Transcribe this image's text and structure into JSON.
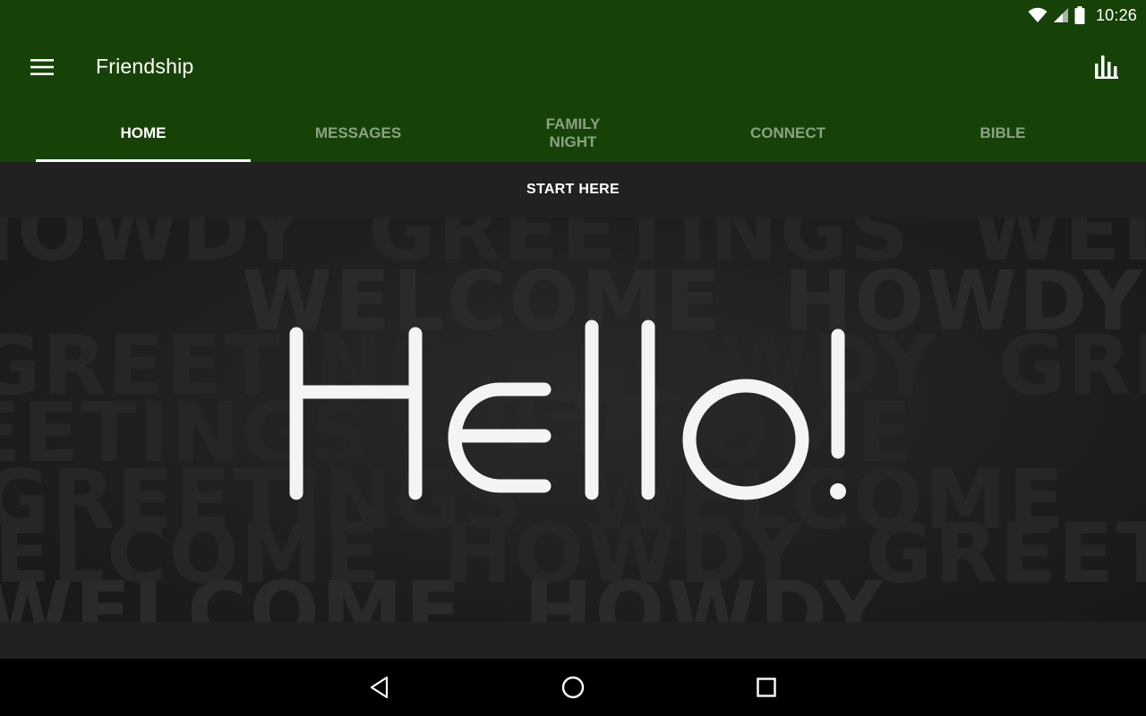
{
  "status_bar": {
    "time": "10:26",
    "icons": [
      "wifi-icon",
      "signal-icon",
      "battery-icon"
    ]
  },
  "app_bar": {
    "title": "Friendship",
    "menu_icon": "hamburger-menu-icon",
    "action_icon": "bar-chart-icon"
  },
  "tabs": [
    {
      "label": "HOME",
      "active": true
    },
    {
      "label": "MESSAGES",
      "active": false
    },
    {
      "label": "FAMILY NIGHT",
      "active": false
    },
    {
      "label": "CONNECT",
      "active": false
    },
    {
      "label": "BIBLE",
      "active": false
    }
  ],
  "start_bar": {
    "label": "START HERE"
  },
  "banner": {
    "headline": "Hello!",
    "background_words": [
      "WELCOME",
      "HOWDY",
      "GREETINGS"
    ]
  },
  "nav_bar": {
    "icons": [
      "back-icon",
      "home-icon",
      "recents-icon"
    ]
  },
  "colors": {
    "primary": "#174207",
    "tab_inactive": "#8aa283",
    "surface": "#212121",
    "nav": "#000000"
  }
}
